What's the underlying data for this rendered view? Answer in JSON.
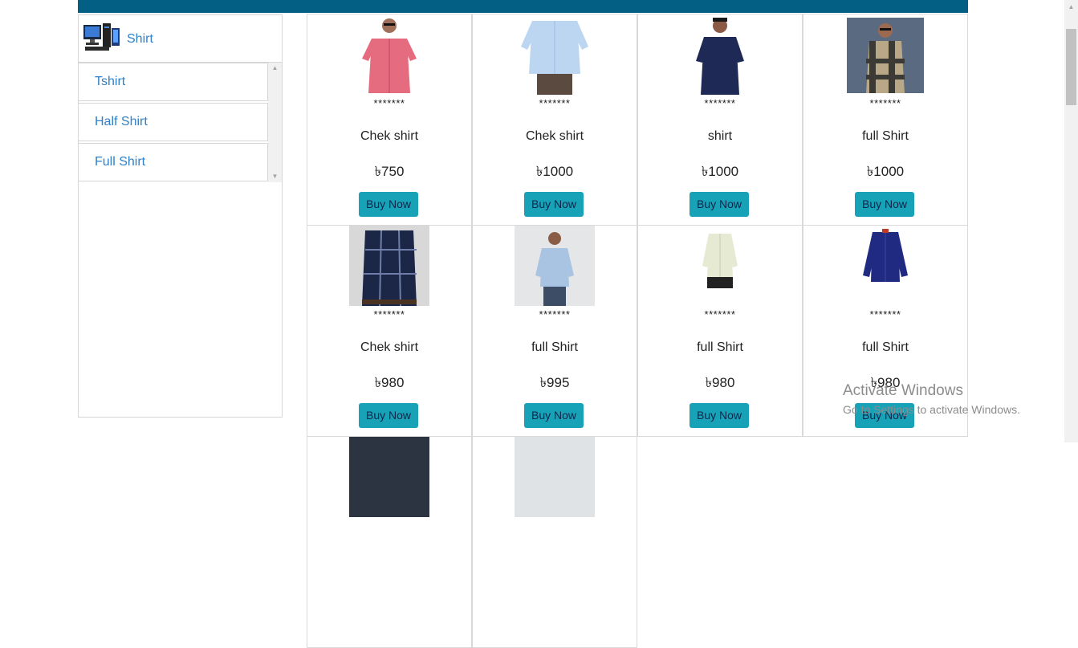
{
  "sidebar": {
    "category": "Shirt",
    "items": [
      {
        "label": "Tshirt"
      },
      {
        "label": "Half Shirt"
      },
      {
        "label": "Full Shirt"
      }
    ]
  },
  "products": [
    {
      "stars": "*******",
      "name": "Chek shirt",
      "price": "৳750",
      "button": "Buy Now"
    },
    {
      "stars": "*******",
      "name": "Chek shirt",
      "price": "৳1000",
      "button": "Buy Now"
    },
    {
      "stars": "*******",
      "name": "shirt",
      "price": "৳1000",
      "button": "Buy Now"
    },
    {
      "stars": "*******",
      "name": "full Shirt",
      "price": "৳1000",
      "button": "Buy Now"
    },
    {
      "stars": "*******",
      "name": "Chek shirt",
      "price": "৳980",
      "button": "Buy Now"
    },
    {
      "stars": "*******",
      "name": "full Shirt",
      "price": "৳995",
      "button": "Buy Now"
    },
    {
      "stars": "*******",
      "name": "full Shirt",
      "price": "৳980",
      "button": "Buy Now"
    },
    {
      "stars": "*******",
      "name": "full Shirt",
      "price": "৳980",
      "button": "Buy Now"
    }
  ],
  "watermark": {
    "title": "Activate Windows",
    "subtitle": "Go to Settings to activate Windows."
  },
  "colors": {
    "topbar": "#035f84",
    "link": "#2f80c7",
    "button": "#17a2b8"
  }
}
